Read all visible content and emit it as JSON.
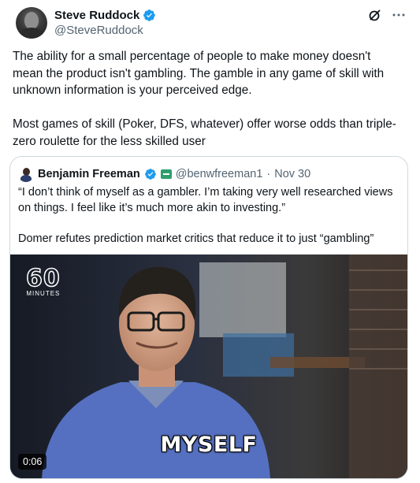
{
  "author": {
    "display_name": "Steve Ruddock",
    "handle": "@SteveRuddock",
    "verified": true,
    "avatar_icon": "profile-photo"
  },
  "header_actions": {
    "grok_icon": "grok-icon",
    "more_icon": "more-icon",
    "more_label": "···"
  },
  "tweet_text": "The ability for a small percentage of people to make money doesn't mean the product isn't gambling. The gamble in any game of skill with unknown information is your perceived edge.\n\nMost games of skill (Poker, DFS, whatever) offer worse odds than triple-zero roulette for the less skilled user",
  "quote": {
    "display_name": "Benjamin Freeman",
    "handle": "@benwfreeman1",
    "separator": "·",
    "date": "Nov 30",
    "verified": true,
    "affiliate_icon": "flag-icon",
    "text": "“I don’t think of myself as a gambler. I’m taking very well researched views on things. I feel like it’s much more akin to investing.”\n\nDomer refutes prediction market critics that reduce it to just “gambling”",
    "media": {
      "logo_number": "60",
      "logo_text": "MINUTES",
      "caption": "MYSELF",
      "duration": "0:06"
    }
  },
  "colors": {
    "text_primary": "#0f1419",
    "text_secondary": "#536471",
    "verified_blue": "#1d9bf0",
    "border": "#cfd9de"
  }
}
